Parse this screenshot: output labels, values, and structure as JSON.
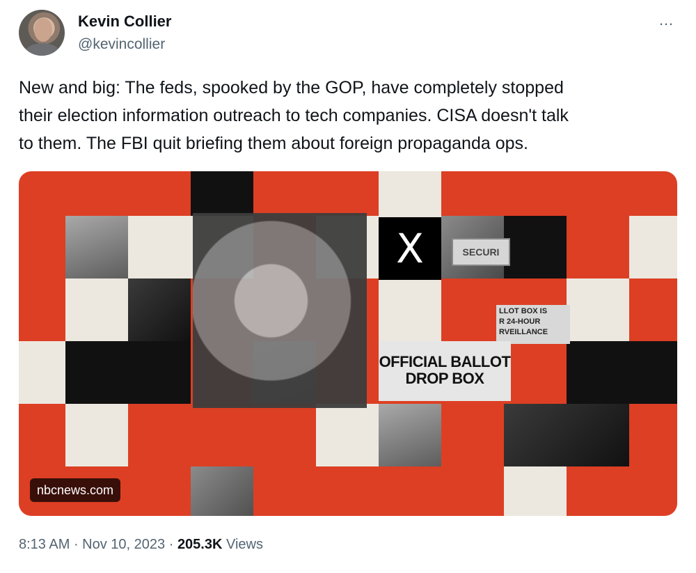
{
  "author": {
    "name": "Kevin Collier",
    "handle": "@kevincollier"
  },
  "more_icon": "…",
  "tweet": {
    "text": "New and big: The feds, spooked by the GOP, have completely stopped\ntheir election information outreach to tech companies. CISA doesn't talk\nto them. The FBI quit briefing them about foreign propaganda ops."
  },
  "media": {
    "link_label": "nbcnews.com",
    "image_texts": {
      "x_logo": "X",
      "security": "SECURI",
      "ballot_small": "LLOT BOX IS\nR 24-HOUR\nRVEILLANCE",
      "ballot_big": "OFFICIAL BALLOT\nDROP BOX"
    },
    "colors": {
      "accent": "#dd3f24",
      "cream": "#ece8df",
      "black": "#111111"
    }
  },
  "meta": {
    "time": "8:13 AM",
    "separator": " · ",
    "date": "Nov 10, 2023",
    "views_count": "205.3K",
    "views_label": "Views"
  }
}
